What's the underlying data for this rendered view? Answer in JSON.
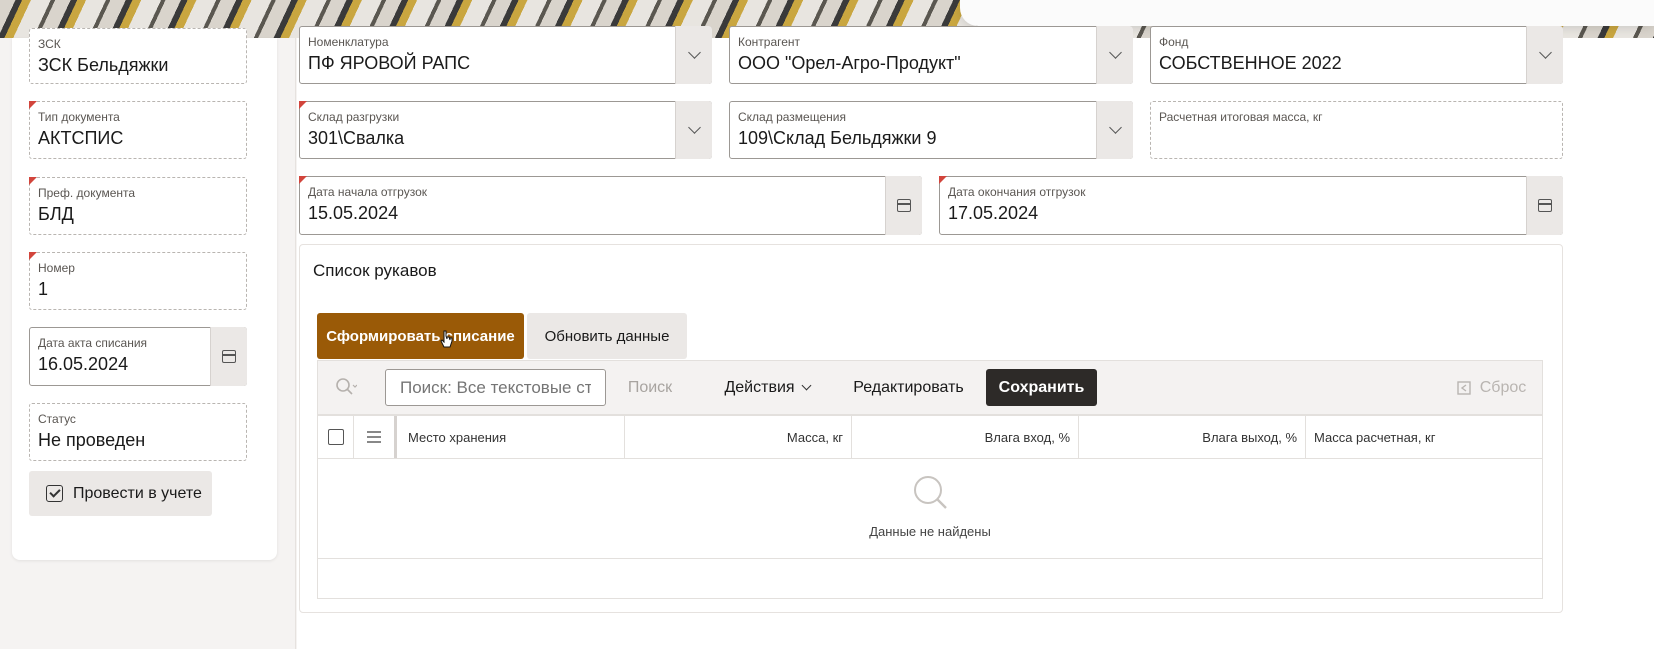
{
  "left_panel": {
    "zsk": {
      "label": "ЗСК",
      "value": "ЗСК Бельдяжки"
    },
    "doc_type": {
      "label": "Тип документа",
      "value": "АКТСПИС"
    },
    "doc_prefix": {
      "label": "Преф. документа",
      "value": "БЛД"
    },
    "number": {
      "label": "Номер",
      "value": "1"
    },
    "act_date": {
      "label": "Дата акта списания",
      "value": "16.05.2024"
    },
    "status": {
      "label": "Статус",
      "value": "Не проведен"
    },
    "post_button": "Провести в учете"
  },
  "form": {
    "nomenclature": {
      "label": "Номенклатура",
      "value": "ПФ ЯРОВОЙ РАПС"
    },
    "counterparty": {
      "label": "Контрагент",
      "value": "ООО \"Орел-Агро-Продукт\""
    },
    "fund": {
      "label": "Фонд",
      "value": "СОБСТВЕННОЕ 2022"
    },
    "unload_warehouse": {
      "label": "Склад разгрузки",
      "value": "301\\Свалка"
    },
    "placement_warehouse": {
      "label": "Склад размещения",
      "value": "109\\Склад Бельдяжки 9"
    },
    "calc_total_mass": {
      "label": "Расчетная итоговая масса, кг",
      "value": ""
    },
    "ship_start": {
      "label": "Дата начала отгрузок",
      "value": "15.05.2024"
    },
    "ship_end": {
      "label": "Дата окончания отгрузок",
      "value": "17.05.2024"
    }
  },
  "sleeves": {
    "title": "Список рукавов",
    "form_writeoff_button": "Сформировать списание",
    "refresh_button": "Обновить данные",
    "toolbar": {
      "search_placeholder": "Поиск: Все текстовые ст",
      "search_button": "Поиск",
      "actions_menu": "Действия",
      "edit_button": "Редактировать",
      "save_button": "Сохранить",
      "reset_button": "Сброс"
    },
    "columns": [
      "Место хранения",
      "Масса, кг",
      "Влага вход, %",
      "Влага выход, %",
      "Масса расчетная, кг"
    ],
    "empty_text": "Данные не найдены"
  },
  "colors": {
    "primary_button": "#9a5a07",
    "save_button": "#2d2a28",
    "required_marker": "#d2453c"
  }
}
